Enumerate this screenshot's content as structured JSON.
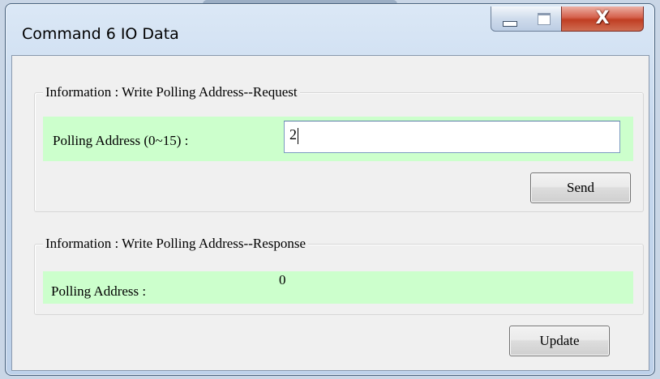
{
  "window": {
    "title": "Command 6 IO Data",
    "close_glyph": "X"
  },
  "request": {
    "group_label": "Information : Write Polling Address--Request",
    "field_label": "Polling Address (0~15) :",
    "field_value": "2",
    "send_label": "Send"
  },
  "response": {
    "group_label": "Information : Write Polling Address--Response",
    "field_label": "Polling Address :",
    "field_value": "0",
    "update_label": "Update"
  },
  "colors": {
    "highlight_row": "#ccffcc",
    "dialog_bg": "#f0f0f0",
    "close_button": "#c03e23"
  },
  "icons": [
    "minimize-icon",
    "maximize-icon",
    "close-icon"
  ]
}
